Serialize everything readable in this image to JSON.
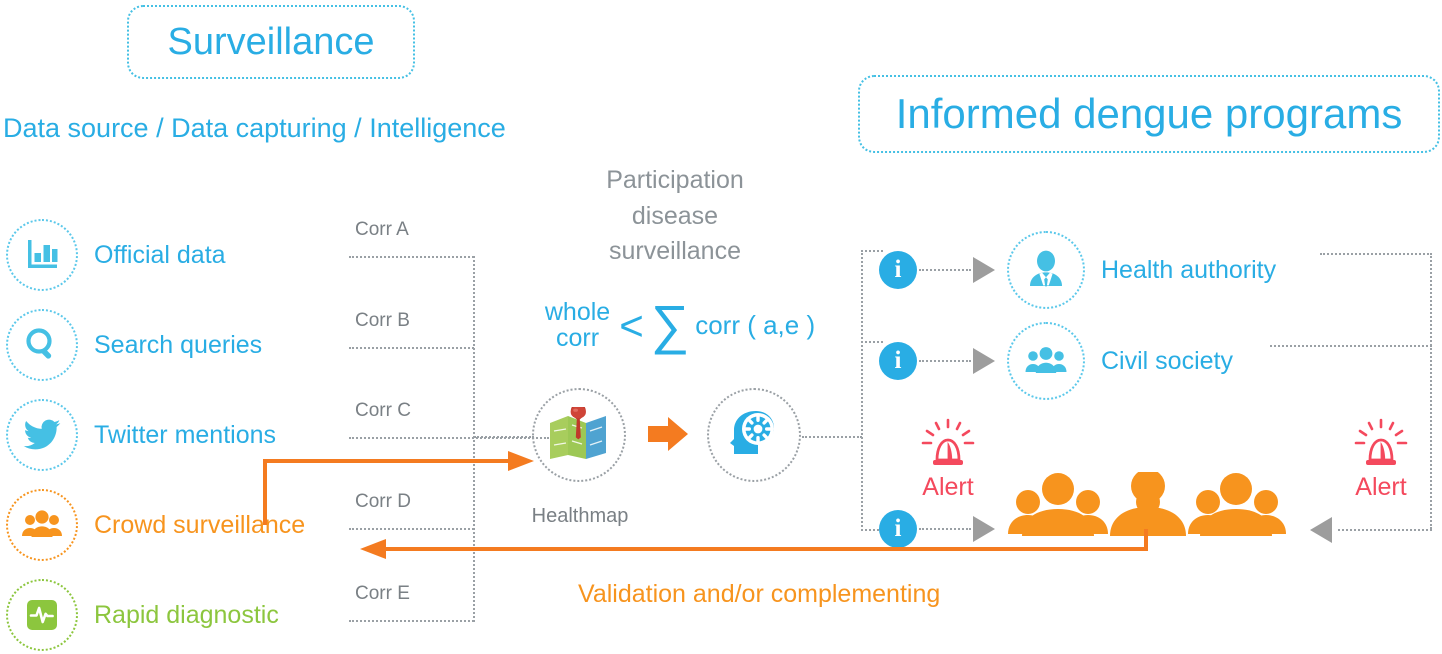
{
  "titles": {
    "surveillance": "Surveillance",
    "programs": "Informed dengue programs"
  },
  "subtitle": "Data source / Data capturing / Intelligence",
  "sources": [
    {
      "label": "Official data",
      "icon": "bar-chart-icon",
      "color": "#29ade4"
    },
    {
      "label": "Search queries",
      "icon": "magnifier-icon",
      "color": "#29ade4"
    },
    {
      "label": "Twitter mentions",
      "icon": "twitter-bird-icon",
      "color": "#29ade4"
    },
    {
      "label": "Crowd surveillance",
      "icon": "crowd-group-icon",
      "color": "#f7941e"
    },
    {
      "label": "Rapid diagnostic",
      "icon": "heartbeat-square-icon",
      "color": "#8cc63e"
    }
  ],
  "correlations": [
    {
      "label": "Corr A"
    },
    {
      "label": "Corr B"
    },
    {
      "label": "Corr C"
    },
    {
      "label": "Corr D"
    },
    {
      "label": "Corr E"
    }
  ],
  "center": {
    "participation": "Participation\ndisease\nsurveillance",
    "participation_lines": [
      "Participation",
      "disease",
      "surveillance"
    ],
    "formula": {
      "left_top": "whole",
      "left_bottom": "corr",
      "operator": "<",
      "sigma": "∑",
      "right": "corr ( a,e )"
    },
    "healthmap_caption": "Healthmap",
    "healthmap_icon": "folded-map-pin-icon",
    "brain_icon": "brain-gear-icon",
    "arrow_icon": "orange-right-arrow-icon"
  },
  "programs": [
    {
      "label": "Health authority",
      "icon": "person-tie-icon",
      "info": "i"
    },
    {
      "label": "Civil society",
      "icon": "people-group-icon",
      "info": "i"
    }
  ],
  "crowd": {
    "info": "i",
    "icon": "orange-crowd-icon"
  },
  "alerts": [
    {
      "label": "Alert",
      "icon": "siren-icon",
      "color": "#f4495d"
    },
    {
      "label": "Alert",
      "icon": "siren-icon",
      "color": "#f4495d"
    }
  ],
  "validation_text": "Validation and/or complementing",
  "colors": {
    "blue": "#29ade4",
    "blue_light": "#5bc8ea",
    "orange": "#f7941e",
    "green": "#8cc63e",
    "red": "#f4495d",
    "gray": "#9aa0a5",
    "gray_text": "#7a8085",
    "arrow_gray": "#9d9d9d"
  }
}
